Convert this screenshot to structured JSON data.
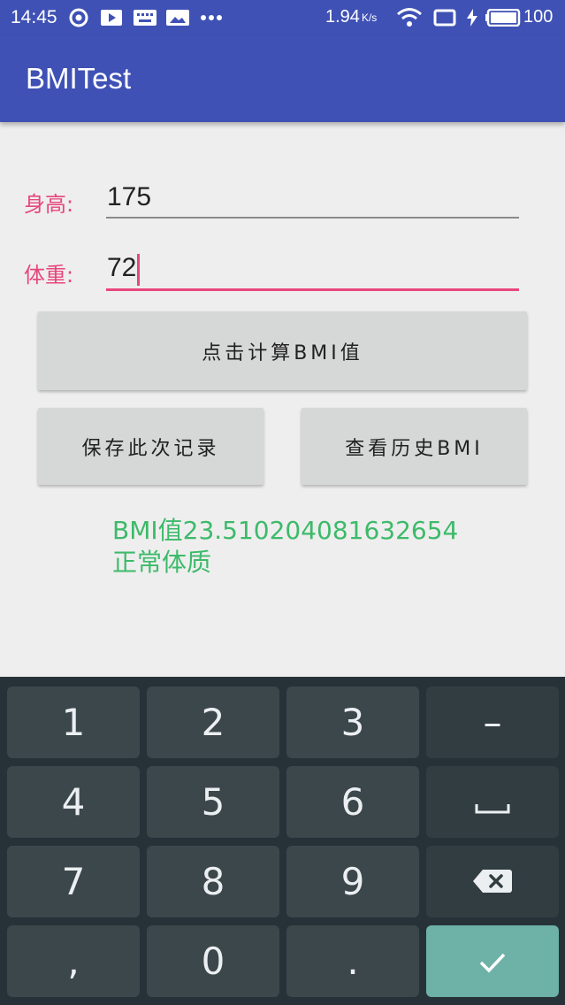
{
  "status_bar": {
    "time": "14:45",
    "net_speed": "1.94",
    "net_speed_unit": "K/s",
    "battery": "100",
    "icons": [
      "sync-icon",
      "play-store-icon",
      "keyboard-icon",
      "image-icon",
      "more-dots-icon",
      "wifi-icon",
      "screen-cast-icon",
      "charging-icon",
      "battery-icon"
    ]
  },
  "app_bar": {
    "title": "BMITest"
  },
  "form": {
    "height_label": "身高:",
    "height_value": "175",
    "weight_label": "体重:",
    "weight_value": "72"
  },
  "buttons": {
    "calculate": "点击计算BMI值",
    "save": "保存此次记录",
    "history": "查看历史BMI"
  },
  "result": {
    "bmi_line": "BMI值23.510204081632654",
    "status_line": "正常体质"
  },
  "keyboard": {
    "row1": [
      "1",
      "2",
      "3",
      "–"
    ],
    "row2": [
      "4",
      "5",
      "6"
    ],
    "row3": [
      "7",
      "8",
      "9"
    ],
    "row4": [
      ",",
      "0",
      "."
    ],
    "space_icon": "space-icon",
    "backspace_icon": "backspace-icon",
    "done_icon": "checkmark-icon"
  },
  "colors": {
    "primary": "#3f51b5",
    "accent": "#e8467c",
    "result_text": "#3dba6a",
    "keyboard_bg": "#263238",
    "done_key": "#6db1a7"
  }
}
